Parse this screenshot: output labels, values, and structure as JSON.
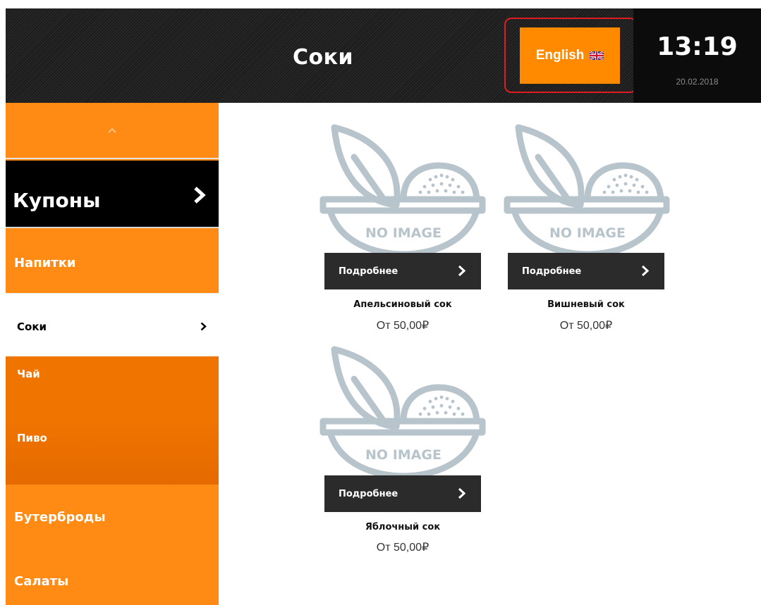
{
  "header": {
    "title": "Соки",
    "language_label": "English",
    "time": "13:19",
    "date": "20.02.2018"
  },
  "sidebar": {
    "coupons_label": "Купоны",
    "categories": [
      {
        "label": "Напитки"
      },
      {
        "label": "Соки"
      },
      {
        "label": "Чай"
      },
      {
        "label": "Пиво"
      },
      {
        "label": "Бутерброды"
      },
      {
        "label": "Салаты"
      }
    ]
  },
  "products": [
    {
      "name": "Апельсиновый сок",
      "price": "От 50,00₽",
      "image_text": "NO IMAGE",
      "details_label": "Подробнее"
    },
    {
      "name": "Вишневый сок",
      "price": "От 50,00₽",
      "image_text": "NO IMAGE",
      "details_label": "Подробнее"
    },
    {
      "name": "Яблочный сок",
      "price": "От 50,00₽",
      "image_text": "NO IMAGE",
      "details_label": "Подробнее"
    }
  ],
  "colors": {
    "accent": "#ff8a14",
    "accent_dark": "#f07400",
    "header_bg": "#1f1f1f",
    "button_dark": "#2b2b2b",
    "highlight_outline": "#e01b22",
    "placeholder_gray": "#b8c4cc"
  },
  "icons": [
    "chevron-up-icon",
    "chevron-right-icon",
    "uk-flag-icon",
    "no-image-placeholder-icon"
  ]
}
